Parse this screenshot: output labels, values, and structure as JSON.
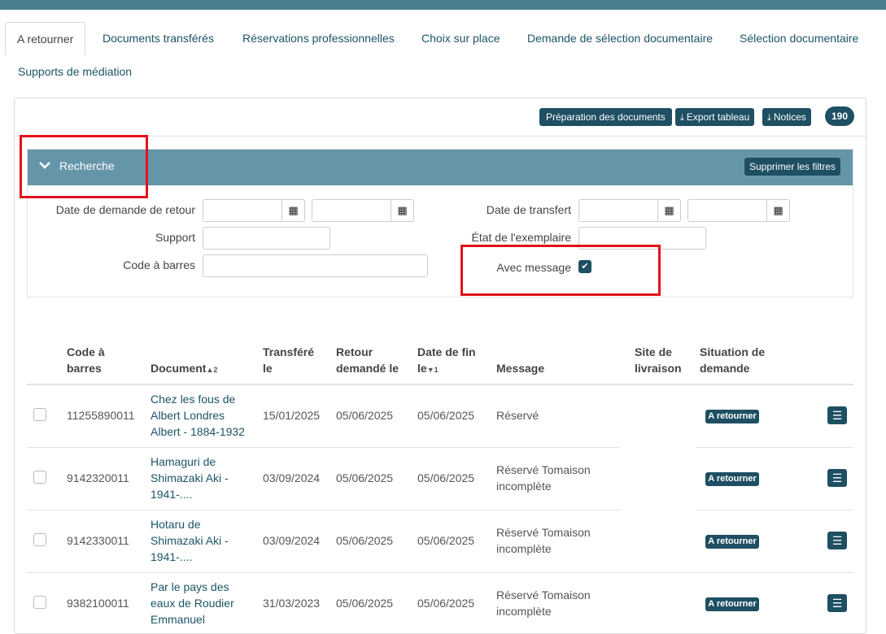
{
  "tabs": [
    {
      "label": "A retourner"
    },
    {
      "label": "Documents transférés"
    },
    {
      "label": "Réservations professionnelles"
    },
    {
      "label": "Choix sur place"
    },
    {
      "label": "Demande de sélection documentaire"
    },
    {
      "label": "Sélection documentaire"
    },
    {
      "label": "Supports de médiation"
    }
  ],
  "toolbar": {
    "prep_label": "Préparation des documents",
    "export_label": "Export tableau",
    "notices_label": "Notices",
    "count": "190"
  },
  "search": {
    "title": "Recherche",
    "clear_label": "Supprimer les filtres",
    "date_demande_label": "Date de demande de retour",
    "support_label": "Support",
    "code_barres_label": "Code à barres",
    "date_transfert_label": "Date de transfert",
    "etat_label": "État de l'exemplaire",
    "avec_message_label": "Avec message",
    "avec_message_checked": true
  },
  "table": {
    "headers": {
      "code": "Code à barres",
      "document": "Document",
      "document_sort": "2",
      "transfere": "Transféré le",
      "retour": "Retour demandé le",
      "date_fin": "Date de fin le",
      "date_fin_sort": "1",
      "message": "Message",
      "site": "Site de livraison",
      "situation": "Situation de demande"
    },
    "rows": [
      {
        "code": "11255890011",
        "document": "Chez les fous de Albert Londres Albert - 1884-1932",
        "transfere": "15/01/2025",
        "retour": "05/06/2025",
        "fin": "05/06/2025",
        "message": "Réservé",
        "situation": "A retourner"
      },
      {
        "code": "9142320011",
        "document": "Hamaguri de Shimazaki Aki - 1941-....",
        "transfere": "03/09/2024",
        "retour": "05/06/2025",
        "fin": "05/06/2025",
        "message": "Réservé Tomaison incomplète",
        "situation": "A retourner"
      },
      {
        "code": "9142330011",
        "document": "Hotaru de Shimazaki Aki - 1941-....",
        "transfere": "03/09/2024",
        "retour": "05/06/2025",
        "fin": "05/06/2025",
        "message": "Réservé Tomaison incomplète",
        "situation": "A retourner"
      },
      {
        "code": "9382100011",
        "document": "Par le pays des eaux de Roudier Emmanuel",
        "transfere": "31/03/2023",
        "retour": "05/06/2025",
        "fin": "05/06/2025",
        "message": "Réservé Tomaison incomplète",
        "situation": "A retourner"
      }
    ]
  }
}
